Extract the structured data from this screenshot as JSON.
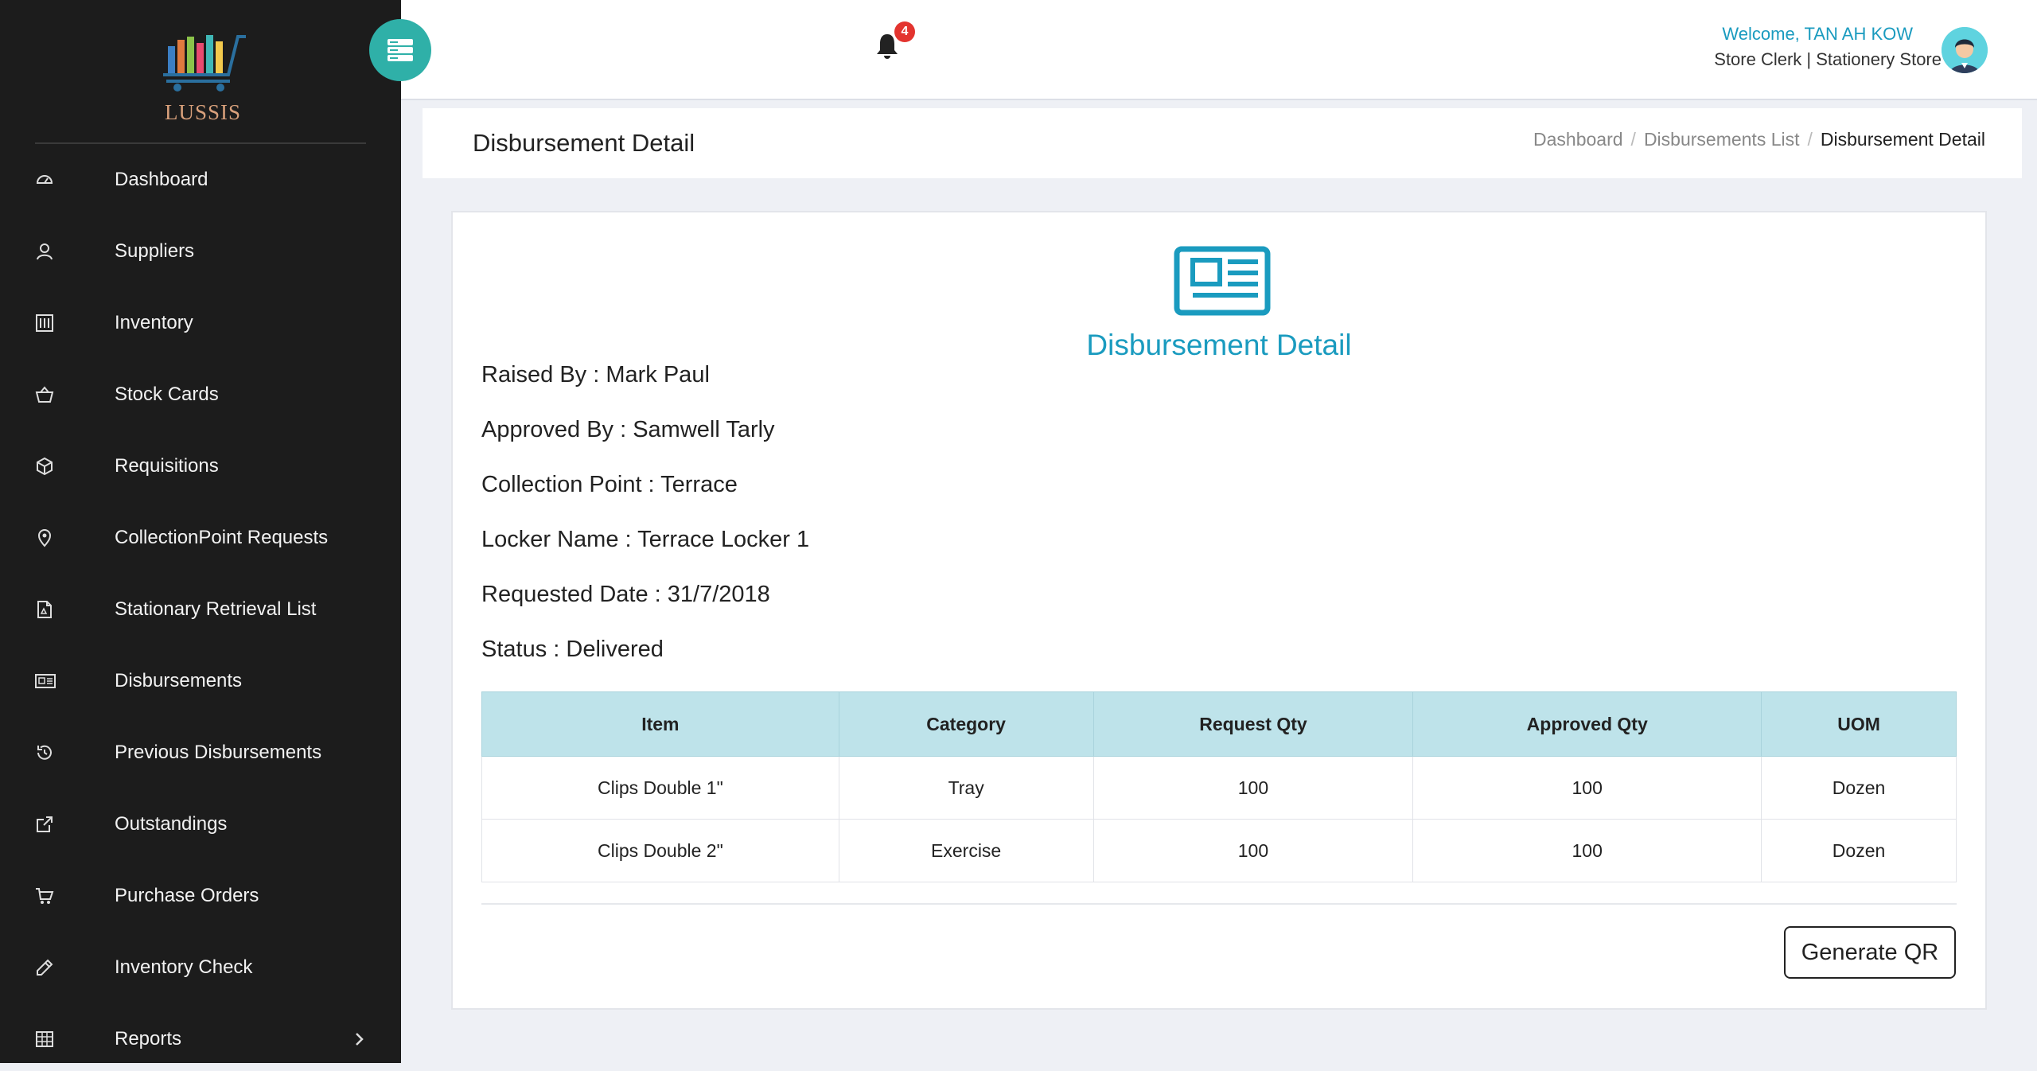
{
  "brand": {
    "name": "LUSSIS"
  },
  "sidebar": {
    "items": [
      {
        "label": "Dashboard",
        "icon": "dashboard-icon"
      },
      {
        "label": "Suppliers",
        "icon": "user-icon"
      },
      {
        "label": "Inventory",
        "icon": "inventory-icon"
      },
      {
        "label": "Stock Cards",
        "icon": "basket-icon"
      },
      {
        "label": "Requisitions",
        "icon": "box-icon"
      },
      {
        "label": "CollectionPoint Requests",
        "icon": "location-icon"
      },
      {
        "label": "Stationary Retrieval List",
        "icon": "pdf-file-icon"
      },
      {
        "label": "Disbursements",
        "icon": "newspaper-icon"
      },
      {
        "label": "Previous Disbursements",
        "icon": "history-icon"
      },
      {
        "label": "Outstandings",
        "icon": "external-link-icon"
      },
      {
        "label": "Purchase Orders",
        "icon": "cart-icon"
      },
      {
        "label": "Inventory Check",
        "icon": "pencil-icon"
      },
      {
        "label": "Reports",
        "icon": "table-icon"
      }
    ]
  },
  "topbar": {
    "notification_count": "4",
    "welcome": "Welcome, TAN AH KOW",
    "role": "Store Clerk | Stationery Store"
  },
  "header": {
    "title": "Disbursement Detail",
    "breadcrumb": [
      "Dashboard",
      "Disbursements List",
      "Disbursement Detail"
    ]
  },
  "card": {
    "heading": "Disbursement Detail",
    "info": [
      "Raised By : Mark Paul",
      "Approved By : Samwell Tarly",
      "Collection Point : Terrace",
      "Locker Name : Terrace Locker 1",
      "Requested Date : 31/7/2018",
      "Status : Delivered"
    ],
    "table": {
      "columns": [
        "Item",
        "Category",
        "Request Qty",
        "Approved Qty",
        "UOM"
      ],
      "rows": [
        [
          "Clips Double 1\"",
          "Tray",
          "100",
          "100",
          "Dozen"
        ],
        [
          "Clips Double 2\"",
          "Exercise",
          "100",
          "100",
          "Dozen"
        ]
      ]
    },
    "qr_button": "Generate QR"
  },
  "colors": {
    "sidebar_bg": "#1c1c1c",
    "accent": "#1a9bbf",
    "toggle": "#2fb0a8",
    "table_header": "#bee3ea",
    "badge": "#e3342f"
  }
}
